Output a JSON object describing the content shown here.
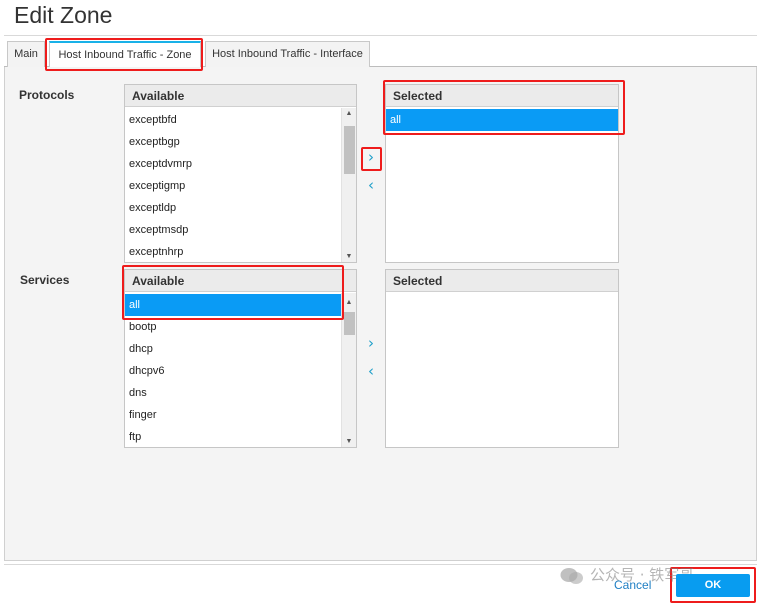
{
  "dialog": {
    "title": "Edit Zone"
  },
  "tabs": [
    {
      "label": "Main"
    },
    {
      "label": "Host Inbound Traffic - Zone"
    },
    {
      "label": "Host Inbound Traffic - Interface"
    }
  ],
  "protocols": {
    "label": "Protocols",
    "available": {
      "header": "Available",
      "items": [
        "exceptbfd",
        "exceptbgp",
        "exceptdvmrp",
        "exceptigmp",
        "exceptldp",
        "exceptmsdp",
        "exceptnhrp"
      ]
    },
    "selected": {
      "header": "Selected",
      "items": [
        "all"
      ]
    },
    "add_icon": "chevron-right-icon",
    "remove_icon": "chevron-left-icon"
  },
  "services": {
    "label": "Services",
    "available": {
      "header": "Available",
      "items": [
        "all",
        "bootp",
        "dhcp",
        "dhcpv6",
        "dns",
        "finger",
        "ftp"
      ]
    },
    "selected": {
      "header": "Selected",
      "items": []
    },
    "add_icon": "chevron-right-icon",
    "remove_icon": "chevron-left-icon"
  },
  "footer": {
    "cancel_label": "Cancel",
    "ok_label": "OK"
  },
  "watermark": {
    "text": "公众号 · 铁军哥"
  },
  "colors": {
    "accent": "#0a9bf5",
    "highlight": "#ee1c1c",
    "link": "#1f7fc4"
  }
}
